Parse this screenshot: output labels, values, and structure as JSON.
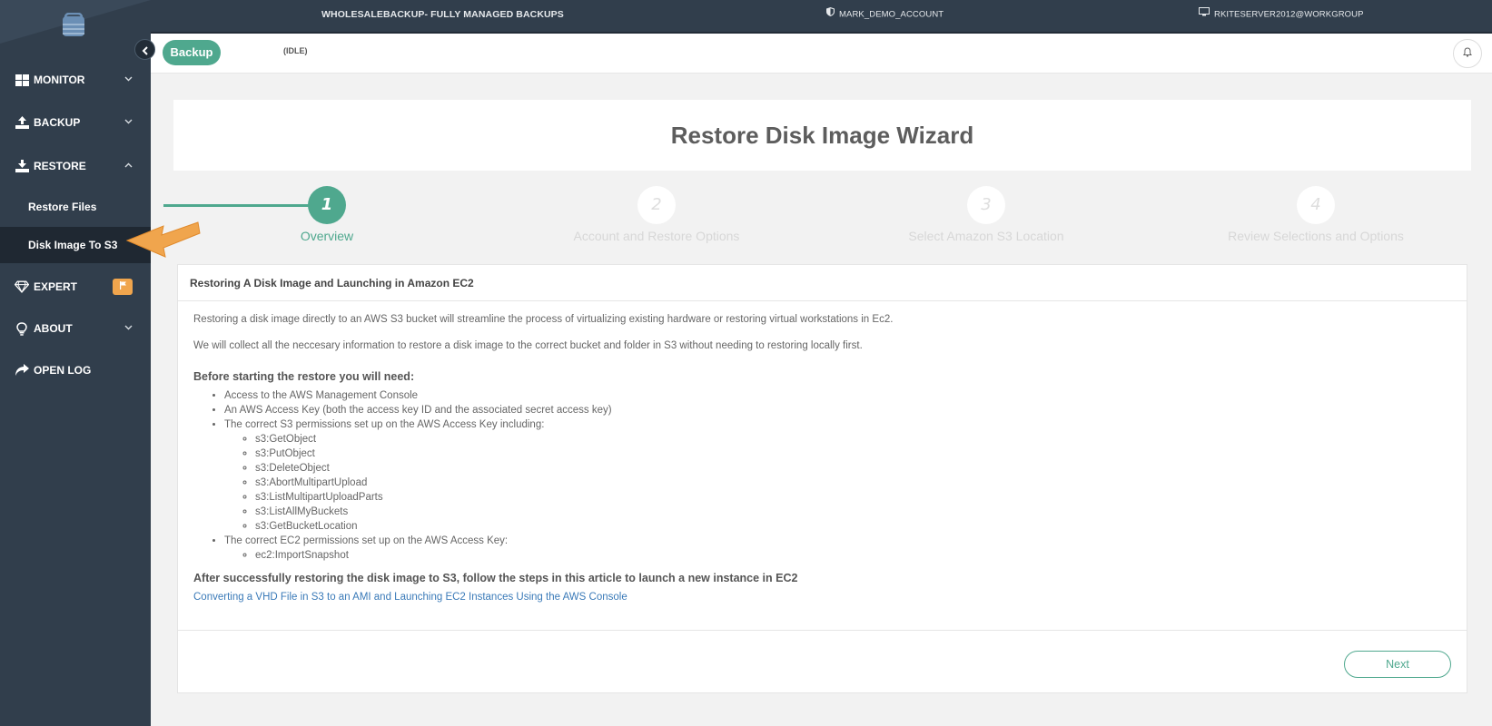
{
  "topbar": {
    "product": "WHOLESALEBACKUP- FULLY MANAGED BACKUPS",
    "account": "MARK_DEMO_ACCOUNT",
    "server": "RKITESERVER2012@WORKGROUP"
  },
  "sidebar": {
    "items": [
      {
        "label": "MONITOR",
        "icon": "dashboard-icon",
        "chevron": "chevron-down-icon"
      },
      {
        "label": "BACKUP",
        "icon": "upload-icon",
        "chevron": "chevron-down-icon"
      },
      {
        "label": "RESTORE",
        "icon": "download-icon",
        "chevron": "chevron-up-icon"
      },
      {
        "label": "EXPERT",
        "icon": "diamond-icon",
        "badge_icon": "flag-icon"
      },
      {
        "label": "ABOUT",
        "icon": "lightbulb-icon",
        "chevron": "chevron-down-icon"
      },
      {
        "label": "OPEN LOG",
        "icon": "share-arrow-icon"
      }
    ],
    "restore_sub": [
      {
        "label": "Restore Files"
      },
      {
        "label": "Disk Image To S3",
        "active": true
      }
    ]
  },
  "header": {
    "backup_label": "Backup",
    "status": "(IDLE)"
  },
  "wizard": {
    "title": "Restore Disk Image Wizard",
    "steps": [
      {
        "number": "1",
        "label": "Overview",
        "active": true
      },
      {
        "number": "2",
        "label": "Account and Restore Options"
      },
      {
        "number": "3",
        "label": "Select Amazon S3 Location"
      },
      {
        "number": "4",
        "label": "Review Selections and Options"
      }
    ]
  },
  "panel": {
    "heading": "Restoring A Disk Image and Launching in Amazon EC2",
    "para1": "Restoring a disk image directly to an AWS S3 bucket will streamline the process of virtualizing existing hardware or restoring virtual workstations in Ec2.",
    "para2": "We will collect all the neccesary information to restore a disk image to the correct bucket and folder in S3 without needing to restoring locally first.",
    "before_heading": "Before starting the restore you will need:",
    "needs": [
      "Access to the AWS Management Console",
      "An AWS Access Key (both the access key ID and the associated secret access key)",
      "The correct S3 permissions set up on the AWS Access Key including:"
    ],
    "s3_permissions": [
      "s3:GetObject",
      "s3:PutObject",
      "s3:DeleteObject",
      "s3:AbortMultipartUpload",
      "s3:ListMultipartUploadParts",
      "s3:ListAllMyBuckets",
      "s3:GetBucketLocation"
    ],
    "ec2_need": "The correct EC2 permissions set up on the AWS Access Key:",
    "ec2_permissions": [
      "ec2:ImportSnapshot"
    ],
    "after_heading": "After successfully restoring the disk image to S3, follow the steps in this article to launch a new instance in EC2",
    "link_text": "Converting a VHD File in S3 to an AMI and Launching EC2 Instances Using the AWS Console",
    "next_label": "Next"
  },
  "colors": {
    "sidebar_bg": "#313e4c",
    "accent": "#4fa88e",
    "annotation_arrow": "#f0a54d"
  }
}
